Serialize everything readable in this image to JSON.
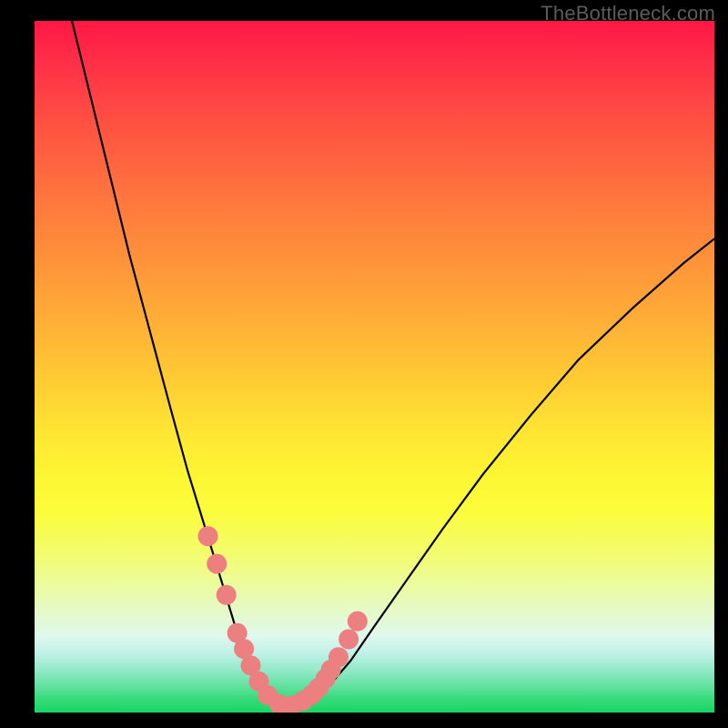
{
  "watermark": "TheBottleneck.com",
  "chart_data": {
    "type": "line",
    "title": "",
    "xlabel": "",
    "ylabel": "",
    "xlim": [
      0,
      1
    ],
    "ylim": [
      0,
      1
    ],
    "series": [
      {
        "name": "bottleneck-curve",
        "x": [
          0.055,
          0.08,
          0.11,
          0.14,
          0.17,
          0.2,
          0.225,
          0.25,
          0.275,
          0.295,
          0.31,
          0.325,
          0.34,
          0.355,
          0.375,
          0.4,
          0.43,
          0.465,
          0.5,
          0.55,
          0.6,
          0.66,
          0.73,
          0.8,
          0.88,
          0.955,
          1.0
        ],
        "y": [
          1.0,
          0.9,
          0.78,
          0.66,
          0.55,
          0.44,
          0.35,
          0.27,
          0.19,
          0.125,
          0.085,
          0.055,
          0.035,
          0.02,
          0.01,
          0.015,
          0.035,
          0.075,
          0.125,
          0.195,
          0.265,
          0.345,
          0.43,
          0.51,
          0.585,
          0.65,
          0.685
        ]
      }
    ],
    "markers": {
      "name": "highlighted-points",
      "x": [
        0.255,
        0.268,
        0.282,
        0.298,
        0.308,
        0.318,
        0.33,
        0.343,
        0.36,
        0.378,
        0.395,
        0.408,
        0.418,
        0.428,
        0.436,
        0.447,
        0.462,
        0.475
      ],
      "y": [
        0.255,
        0.215,
        0.17,
        0.115,
        0.092,
        0.068,
        0.045,
        0.025,
        0.012,
        0.01,
        0.017,
        0.026,
        0.036,
        0.049,
        0.062,
        0.08,
        0.106,
        0.132
      ],
      "color": "#EC7F80",
      "radius_px": 11
    },
    "background_gradient": {
      "top": "#FF1744",
      "mid": "#FFE733",
      "bottom": "#17D763"
    }
  }
}
